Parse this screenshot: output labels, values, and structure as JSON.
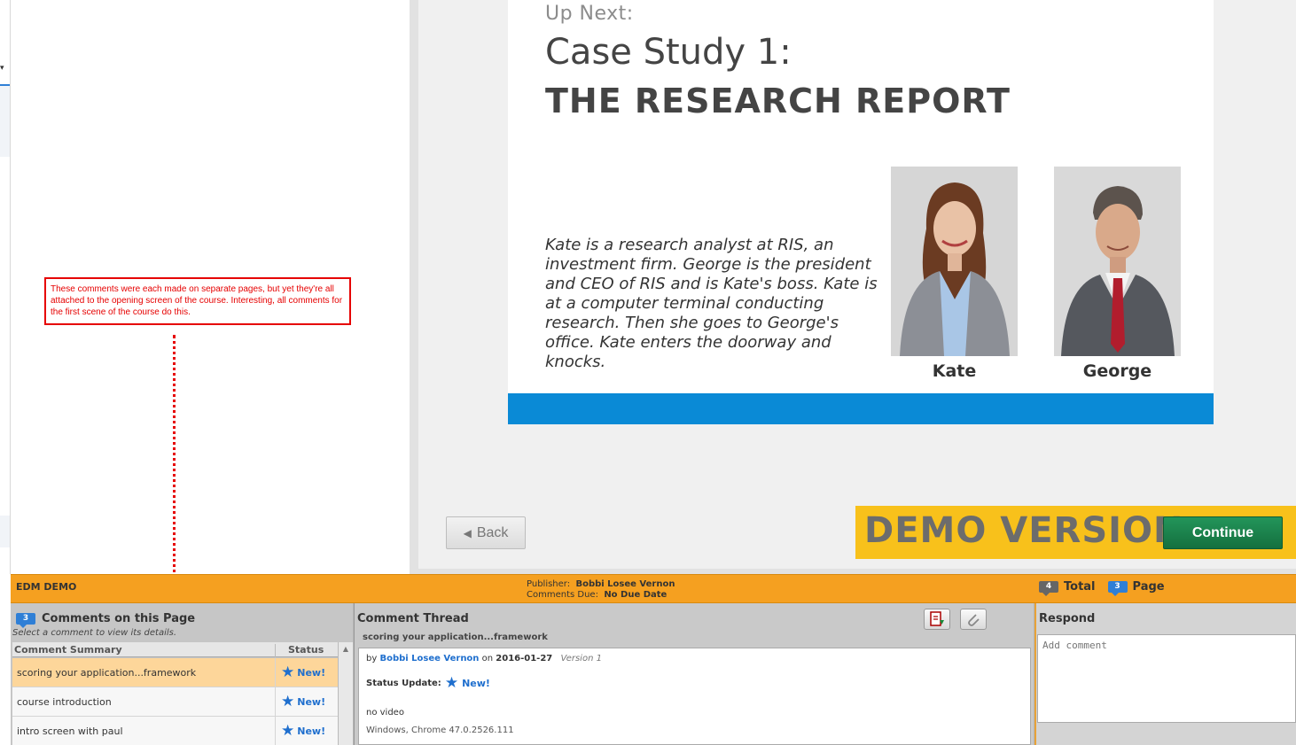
{
  "annotation": {
    "note": "These comments were each made on separate pages, but yet they're all attached to the opening screen of the course. Interesting, all comments for the first scene of the course do this."
  },
  "slide": {
    "up_next": "Up Next:",
    "title": "Case Study 1:",
    "subtitle": "THE RESEARCH REPORT",
    "description": "Kate is a research analyst at RIS, an investment firm. George is the president and CEO of RIS and is Kate's boss. Kate is at a computer terminal conducting research. Then she goes to George's office. Kate enters the doorway and knocks.",
    "people": [
      {
        "name": "Kate",
        "icon": "woman-portrait"
      },
      {
        "name": "George",
        "icon": "man-portrait"
      }
    ]
  },
  "player": {
    "back_label": "Back",
    "demo_label": "DEMO VERSION",
    "continue_label": "Continue",
    "colors": {
      "bar": "#0a8ad6",
      "demo": "#f8c11b",
      "continue": "#1b8a4e"
    }
  },
  "info_bar": {
    "project": "EDM DEMO",
    "publisher_label": "Publisher:",
    "publisher": "Bobbi Losee Vernon",
    "due_label": "Comments Due:",
    "due": "No Due Date",
    "total_count": "4",
    "total_label": "Total",
    "page_count": "3",
    "page_label": "Page",
    "color": "#f5a020"
  },
  "comments_panel": {
    "count": "3",
    "title": "Comments on this Page",
    "subtitle": "Select a comment to view its details.",
    "col_summary": "Comment Summary",
    "col_status": "Status",
    "rows": [
      {
        "summary": "scoring your application...framework",
        "status": "New!"
      },
      {
        "summary": "course introduction",
        "status": "New!"
      },
      {
        "summary": "intro screen with paul",
        "status": "New!"
      }
    ]
  },
  "thread": {
    "title": "Comment Thread",
    "subject": "scoring your application...framework",
    "by": "by",
    "author": "Bobbi Losee Vernon",
    "on": "on",
    "date": "2016-01-27",
    "version": "Version 1",
    "status_label": "Status Update:",
    "status": "New!",
    "text": "no video",
    "env": "Windows, Chrome 47.0.2526.111"
  },
  "respond": {
    "title": "Respond",
    "placeholder": "Add comment"
  }
}
